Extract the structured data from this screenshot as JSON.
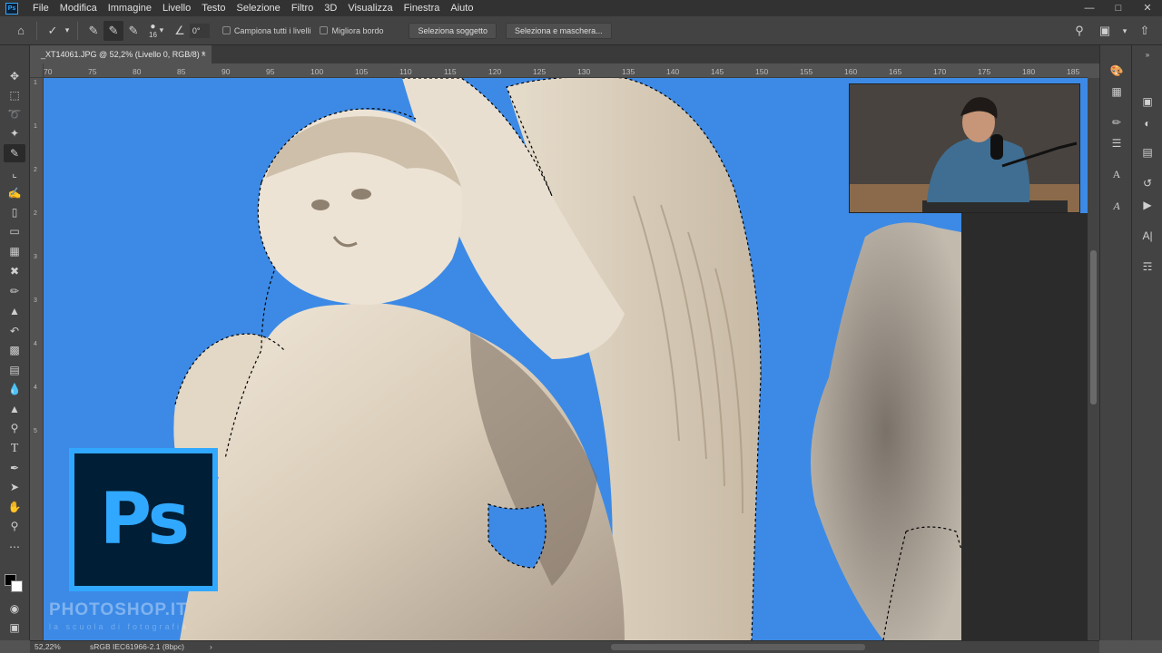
{
  "app": {
    "logo": "Ps",
    "menu": [
      "File",
      "Modifica",
      "Immagine",
      "Livello",
      "Testo",
      "Selezione",
      "Filtro",
      "3D",
      "Visualizza",
      "Finestra",
      "Aiuto"
    ],
    "window_controls": [
      "minimize-icon",
      "maximize-icon",
      "close-icon"
    ]
  },
  "options": {
    "brush_size": "16",
    "angle": "0°",
    "sample_all_layers": "Campiona tutti i livelli",
    "enhance_edge": "Migliora bordo",
    "select_subject": "Seleziona soggetto",
    "select_and_mask": "Seleziona e maschera..."
  },
  "document": {
    "tab_title": "_XT14061.JPG @ 52,2% (Livello 0, RGB/8) *",
    "tab_close": "×"
  },
  "rulers": {
    "top": [
      "70",
      "75",
      "80",
      "85",
      "90",
      "95",
      "100",
      "105",
      "110",
      "115",
      "120",
      "125",
      "130",
      "135",
      "140",
      "145",
      "150",
      "155",
      "160",
      "165",
      "170",
      "175",
      "180",
      "185"
    ],
    "left": [
      "1",
      "1",
      "2",
      "2",
      "3",
      "3",
      "4",
      "4",
      "5"
    ]
  },
  "overlay": {
    "badge": "Ps",
    "watermark": "PHOTOSHOP.IT",
    "watermark_sub": "la scuola di fotografia"
  },
  "status": {
    "zoom": "52,22%",
    "profile": "sRGB IEC61966-2.1 (8bpc)",
    "arrow": "›"
  },
  "colors": {
    "sky": "#3c8ae6",
    "stone": "#e8ddcc",
    "ps_blue": "#31a8ff",
    "ps_dark": "#001e36",
    "ui_dark": "#323232",
    "ui_mid": "#434343"
  }
}
